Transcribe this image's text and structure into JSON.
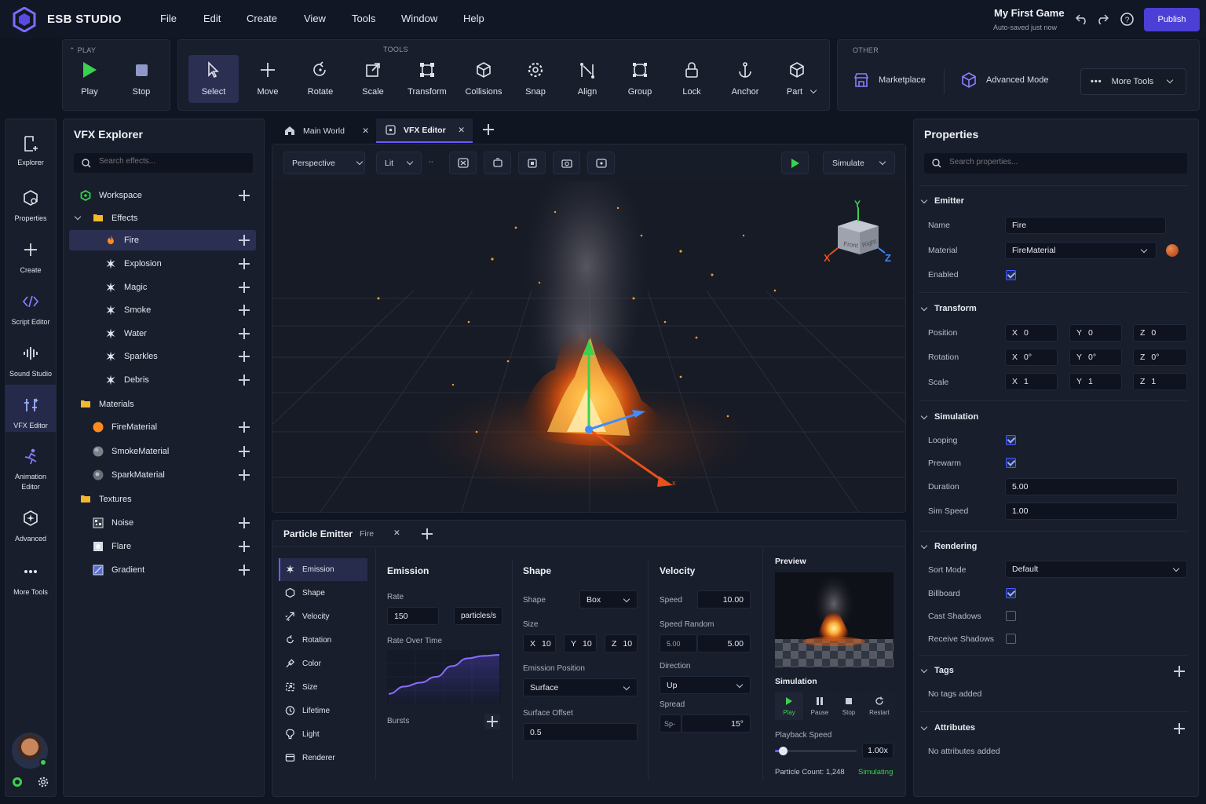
{
  "app": {
    "name": "ESB STUDIO",
    "project": "My First Game",
    "autosave": "Auto-saved just now",
    "publish": "Publish"
  },
  "menu": [
    "File",
    "Edit",
    "Create",
    "View",
    "Tools",
    "Window",
    "Help"
  ],
  "play": {
    "section": "PLAY",
    "play": "Play",
    "stop": "Stop"
  },
  "tools": {
    "section": "TOOLS",
    "items": [
      "Select",
      "Move",
      "Rotate",
      "Scale",
      "Transform",
      "Collisions",
      "Snap",
      "Align",
      "Group",
      "Lock",
      "Anchor",
      "Part"
    ]
  },
  "other": {
    "section": "OTHER",
    "marketplace": "Marketplace",
    "advanced": "Advanced Mode",
    "more": "More Tools"
  },
  "rail": [
    "Explorer",
    "Properties",
    "Create",
    "Script Editor",
    "Sound Studio",
    "VFX Editor",
    "Animation Editor",
    "Advanced",
    "More Tools"
  ],
  "explorer": {
    "title": "VFX Explorer",
    "search_placeholder": "Search effects...",
    "workspace": "Workspace",
    "effects_folder": "Effects",
    "effects": [
      "Fire",
      "Explosion",
      "Magic",
      "Smoke",
      "Water",
      "Sparkles",
      "Debris"
    ],
    "materials_folder": "Materials",
    "materials": [
      "FireMaterial",
      "SmokeMaterial",
      "SparkMaterial"
    ],
    "textures_folder": "Textures",
    "textures": [
      "Noise",
      "Flare",
      "Gradient"
    ]
  },
  "tabs": {
    "main_world": "Main World",
    "vfx_editor": "VFX Editor"
  },
  "viewport": {
    "view_mode": "Perspective",
    "shading": "Lit",
    "simulate": "Simulate",
    "gizmo": {
      "y": "Y",
      "x": "X",
      "z": "Z",
      "front": "Front",
      "right": "Right"
    }
  },
  "emitter_panel": {
    "title": "Particle Emitter",
    "name": "Fire",
    "sections": [
      "Emission",
      "Shape",
      "Velocity",
      "Rotation",
      "Color",
      "Size",
      "Lifetime",
      "Light",
      "Renderer"
    ],
    "emission": {
      "title": "Emission",
      "rate_label": "Rate",
      "rate": "150",
      "rate_unit": "particles/s",
      "rate_over_time": "Rate Over Time",
      "bursts": "Bursts",
      "curve": [
        0.15,
        0.3,
        0.38,
        0.5,
        0.72,
        0.88,
        0.93,
        0.95
      ]
    },
    "shape": {
      "title": "Shape",
      "shape_label": "Shape",
      "shape": "Box",
      "size_label": "Size",
      "x": "10",
      "y": "10",
      "z": "10",
      "emission_position_label": "Emission Position",
      "emission_position": "Surface",
      "surface_offset_label": "Surface Offset",
      "surface_offset": "0.5"
    },
    "velocity": {
      "title": "Velocity",
      "speed_label": "Speed",
      "speed": "10.00",
      "speed_random_label": "Speed Random",
      "speed_random_min": "5.00",
      "speed_random": "5.00",
      "direction_label": "Direction",
      "direction": "Up",
      "spread_label": "Spread",
      "spread_prefix": "Sp-",
      "spread": "15°"
    },
    "preview": {
      "title": "Preview",
      "simulation": "Simulation",
      "play": "Play",
      "pause": "Pause",
      "stop": "Stop",
      "restart": "Restart",
      "playback_label": "Playback Speed",
      "playback": "1.00x",
      "playback_fraction": 0.1,
      "particle_count": "Particle Count: 1,248",
      "status": "Simulating"
    }
  },
  "properties": {
    "title": "Properties",
    "search_placeholder": "Search properties...",
    "emitter": {
      "title": "Emitter",
      "name_label": "Name",
      "name": "Fire",
      "material_label": "Material",
      "material": "FireMaterial",
      "enabled_label": "Enabled"
    },
    "transform": {
      "title": "Transform",
      "position_label": "Position",
      "rotation_label": "Rotation",
      "scale_label": "Scale",
      "position": {
        "x": "0",
        "y": "0",
        "z": "0"
      },
      "rotation": {
        "x": "0°",
        "y": "0°",
        "z": "0°"
      },
      "scale": {
        "x": "1",
        "y": "1",
        "z": "1"
      }
    },
    "simulation": {
      "title": "Simulation",
      "looping": "Looping",
      "prewarm": "Prewarm",
      "duration_label": "Duration",
      "duration": "5.00",
      "sim_speed_label": "Sim Speed",
      "sim_speed": "1.00"
    },
    "rendering": {
      "title": "Rendering",
      "sort_mode_label": "Sort Mode",
      "sort_mode": "Default",
      "billboard": "Billboard",
      "cast_shadows": "Cast Shadows",
      "receive_shadows": "Receive Shadows"
    },
    "tags": {
      "title": "Tags",
      "empty": "No tags added"
    },
    "attributes": {
      "title": "Attributes",
      "empty": "No attributes added"
    }
  },
  "colors": {
    "accent": "#4b3fd6",
    "fire": "#ff8a1e",
    "bg": "#101522",
    "panel": "#181e2c",
    "gizmo_y": "#3ad14c",
    "gizmo_x": "#e8501c",
    "gizmo_z": "#3f8cff"
  }
}
